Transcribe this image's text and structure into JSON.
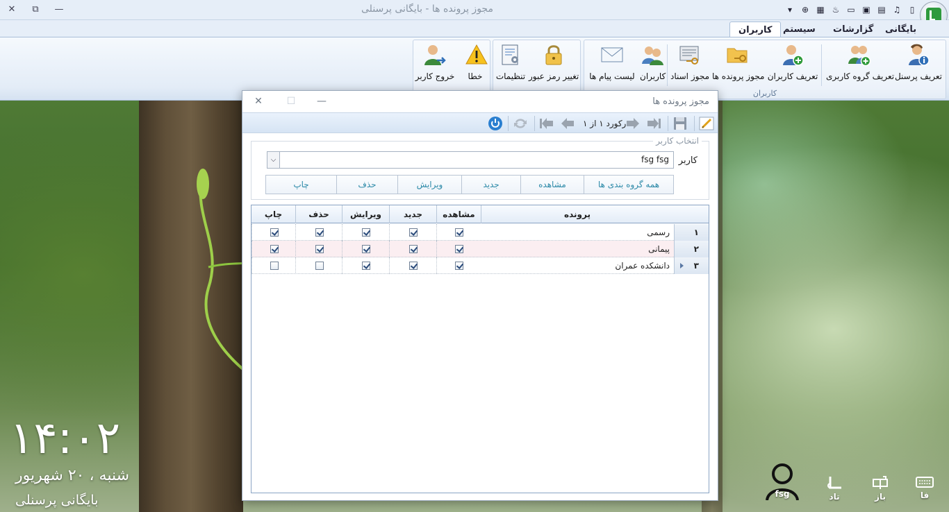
{
  "window": {
    "title": "مجوز پرونده ها - بایگانی پرسنلی"
  },
  "ribbon": {
    "tabs": [
      {
        "label": "بایگانی"
      },
      {
        "label": "گزارشات"
      },
      {
        "label": "سیستم"
      },
      {
        "label": "کاربران",
        "active": true
      }
    ],
    "groups": {
      "users": {
        "caption": "کاربران",
        "buttons": [
          {
            "label": "تعریف پرسنل",
            "icon": "user-info-icon"
          },
          {
            "label": "تعریف گروه کاربری",
            "icon": "user-group-add-icon"
          },
          {
            "label": "تعریف کاربران",
            "icon": "user-add-icon"
          },
          {
            "label": "مجوز پرونده ها",
            "icon": "folder-key-icon"
          },
          {
            "label": "مجوز اسناد",
            "icon": "document-key-icon"
          },
          {
            "label": "کاربران",
            "icon": "users-icon"
          },
          {
            "label": "لیست پیام ها",
            "icon": "mail-icon"
          }
        ]
      },
      "settings": {
        "buttons": [
          {
            "label": "تغییر رمز عبور",
            "icon": "lock-icon"
          },
          {
            "label": "تنظیمات",
            "icon": "settings-document-icon"
          }
        ]
      },
      "misc": {
        "buttons": [
          {
            "label": "خطا",
            "icon": "warning-icon"
          },
          {
            "label": "خروج کاربر",
            "icon": "user-exit-icon"
          }
        ]
      }
    }
  },
  "dialog": {
    "title": "مجوز پرونده ها",
    "toolbar": {
      "record_text": "رکورد ۱ از ۱"
    },
    "user_group": {
      "legend": "انتخاب کاربر",
      "label": "کاربر",
      "selected_user": "fsg fsg",
      "buttons": [
        "همه گروه بندی ها",
        "مشاهده",
        "جدید",
        "ویرایش",
        "حذف",
        "چاپ"
      ]
    },
    "grid": {
      "columns": [
        "پرونده",
        "مشاهده",
        "جدید",
        "ویرایش",
        "حذف",
        "چاپ"
      ],
      "rows": [
        {
          "index": "۱",
          "name": "رسمی",
          "view": true,
          "new": true,
          "edit": true,
          "delete": true,
          "print": true,
          "selected": false
        },
        {
          "index": "۲",
          "name": "پیمانی",
          "view": true,
          "new": true,
          "edit": true,
          "delete": true,
          "print": true,
          "selected": false
        },
        {
          "index": "۳",
          "name": "دانشکده عمران",
          "view": true,
          "new": true,
          "edit": true,
          "delete": false,
          "print": false,
          "selected": true
        }
      ]
    }
  },
  "desktop": {
    "time": "۱۴:۰۲",
    "date": "شنبه ، ۲۰ شهریور",
    "app_name": "بایگانی پرسنلی",
    "dock": [
      {
        "label": "fsg",
        "icon": "user-icon"
      },
      {
        "label": "تاد",
        "icon": "taad-icon"
      },
      {
        "label": "باز",
        "icon": "mailbox-icon"
      },
      {
        "label": "فا",
        "icon": "keyboard-icon"
      }
    ]
  }
}
